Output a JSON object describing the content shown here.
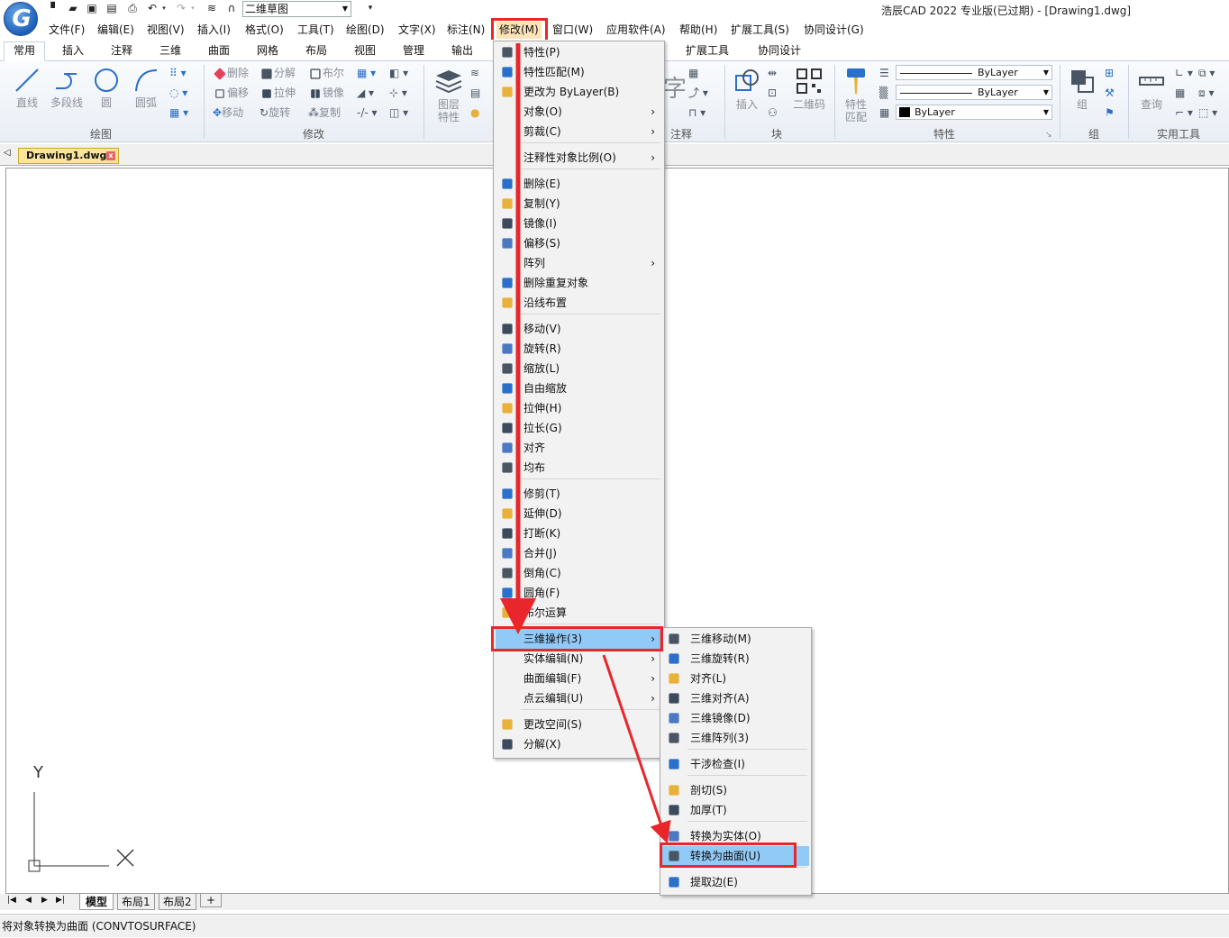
{
  "app": {
    "title": "浩辰CAD 2022 专业版(已过期) - [Drawing1.dwg]",
    "logo_letter": "G",
    "workspace": "二维草图"
  },
  "menubar": [
    "文件(F)",
    "编辑(E)",
    "视图(V)",
    "插入(I)",
    "格式(O)",
    "工具(T)",
    "绘图(D)",
    "文字(X)",
    "标注(N)",
    "修改(M)",
    "窗口(W)",
    "应用软件(A)",
    "帮助(H)",
    "扩展工具(S)",
    "协同设计(G)"
  ],
  "ribbon_tabs": [
    "常用",
    "插入",
    "注释",
    "三维",
    "曲面",
    "网格",
    "布局",
    "视图",
    "管理",
    "输出",
    "扩展工具",
    "协同设计"
  ],
  "ribbon": {
    "draw": {
      "line": "直线",
      "polyline": "多段线",
      "circle": "圆",
      "arc": "圆弧",
      "panel": "绘图"
    },
    "modify": {
      "erase": "删除",
      "explode": "分解",
      "boolean": "布尔",
      "offset": "偏移",
      "stretch": "拉伸",
      "mirror": "镜像",
      "move": "移动",
      "rotate": "旋转",
      "copy": "复制",
      "panel": "修改"
    },
    "layer": {
      "label1": "图层",
      "label2": "特性"
    },
    "annot": {
      "char": "字",
      "panel": "注释"
    },
    "block": {
      "insert": "插入",
      "qrcode": "二维码",
      "panel": "块"
    },
    "props": {
      "match1": "特性",
      "match2": "匹配",
      "bylayer1": "ByLayer",
      "bylayer2": "ByLayer",
      "bylayer3": "ByLayer",
      "panel": "特性"
    },
    "group": {
      "label": "组",
      "panel": "组"
    },
    "util": {
      "query": "查询",
      "panel": "实用工具"
    }
  },
  "document": {
    "tab": "Drawing1.dwg",
    "close": "x"
  },
  "ucs": {
    "y": "Y"
  },
  "layout_tabs": [
    "模型",
    "布局1",
    "布局2",
    "+"
  ],
  "command_line": "将对象转换为曲面 (CONVTOSURFACE)",
  "modify_menu": [
    {
      "label": "特性(P)",
      "icon": "properties-icon"
    },
    {
      "label": "特性匹配(M)",
      "icon": "match-properties-icon"
    },
    {
      "label": "更改为 ByLayer(B)",
      "icon": "bylayer-icon"
    },
    {
      "label": "对象(O)",
      "sub": "›"
    },
    {
      "label": "剪裁(C)",
      "sub": "›"
    },
    {
      "label": "注释性对象比例(O)",
      "sub": "›"
    },
    {
      "label": "删除(E)",
      "icon": "erase-icon"
    },
    {
      "label": "复制(Y)",
      "icon": "copy-icon"
    },
    {
      "label": "镜像(I)",
      "icon": "mirror-icon"
    },
    {
      "label": "偏移(S)",
      "icon": "offset-icon"
    },
    {
      "label": "阵列",
      "sub": "›"
    },
    {
      "label": "删除重复对象",
      "icon": "overkill-icon"
    },
    {
      "label": "沿线布置",
      "icon": "path-array-icon"
    },
    {
      "label": "移动(V)",
      "icon": "move-icon"
    },
    {
      "label": "旋转(R)",
      "icon": "rotate-icon"
    },
    {
      "label": "缩放(L)",
      "icon": "scale-icon"
    },
    {
      "label": "自由缩放",
      "icon": "free-scale-icon"
    },
    {
      "label": "拉伸(H)",
      "icon": "stretch-icon"
    },
    {
      "label": "拉长(G)",
      "icon": "lengthen-icon"
    },
    {
      "label": "对齐",
      "icon": "align-icon"
    },
    {
      "label": "均布",
      "icon": "distribute-icon"
    },
    {
      "label": "修剪(T)",
      "icon": "trim-icon"
    },
    {
      "label": "延伸(D)",
      "icon": "extend-icon"
    },
    {
      "label": "打断(K)",
      "icon": "break-icon"
    },
    {
      "label": "合并(J)",
      "icon": "join-icon"
    },
    {
      "label": "倒角(C)",
      "icon": "chamfer-icon"
    },
    {
      "label": "圆角(F)",
      "icon": "fillet-icon"
    },
    {
      "label": "布尔运算",
      "icon": "boolean-icon"
    },
    {
      "label": "三维操作(3)",
      "sub": "›",
      "highlight": true
    },
    {
      "label": "实体编辑(N)",
      "sub": "›"
    },
    {
      "label": "曲面编辑(F)",
      "sub": "›"
    },
    {
      "label": "点云编辑(U)",
      "sub": "›"
    },
    {
      "label": "更改空间(S)",
      "icon": "change-space-icon"
    },
    {
      "label": "分解(X)",
      "icon": "explode-icon"
    }
  ],
  "ops3d_menu": [
    {
      "label": "三维移动(M)",
      "icon": "3d-move-icon"
    },
    {
      "label": "三维旋转(R)",
      "icon": "3d-rotate-icon"
    },
    {
      "label": "对齐(L)",
      "icon": "3d-align-icon"
    },
    {
      "label": "三维对齐(A)",
      "icon": "3d-align2-icon"
    },
    {
      "label": "三维镜像(D)",
      "icon": "3d-mirror-icon"
    },
    {
      "label": "三维阵列(3)",
      "icon": "3d-array-icon"
    },
    {
      "label": "干涉检查(I)",
      "icon": "interference-icon"
    },
    {
      "label": "剖切(S)",
      "icon": "slice-icon"
    },
    {
      "label": "加厚(T)",
      "icon": "thicken-icon"
    },
    {
      "label": "转换为实体(O)",
      "icon": "convert-solid-icon"
    },
    {
      "label": "转换为曲面(U)",
      "icon": "convert-surface-icon",
      "highlight": true
    },
    {
      "label": "提取边(E)",
      "icon": "extract-edges-icon"
    }
  ]
}
